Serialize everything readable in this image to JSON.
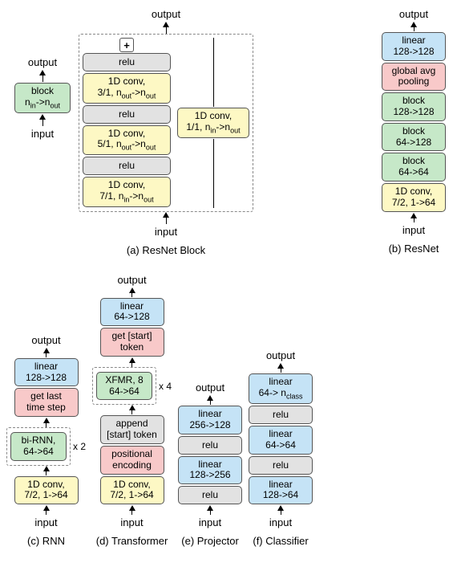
{
  "labels": {
    "input": "input",
    "output": "output"
  },
  "panelA": {
    "caption": "(a) ResNet Block",
    "left_block": {
      "title": "block",
      "dims": "nin->nout"
    },
    "expanded": {
      "plus": "+",
      "relu": "relu",
      "conv3": {
        "l1": "1D conv,",
        "l2": "3/1, nout->nout"
      },
      "conv5": {
        "l1": "1D conv,",
        "l2": "5/1, nout->nout"
      },
      "conv7": {
        "l1": "1D conv,",
        "l2": "7/1, nin->nout"
      },
      "skip": {
        "l1": "1D conv,",
        "l2": "1/1, nin->nout"
      }
    }
  },
  "panelB": {
    "caption": "(b) ResNet",
    "layers": {
      "linear": {
        "l1": "linear",
        "l2": "128->128"
      },
      "gap": {
        "l1": "global avg",
        "l2": "pooling"
      },
      "blk3": {
        "l1": "block",
        "l2": "128->128"
      },
      "blk2": {
        "l1": "block",
        "l2": "64->128"
      },
      "blk1": {
        "l1": "block",
        "l2": "64->64"
      },
      "conv": {
        "l1": "1D conv,",
        "l2": "7/2, 1->64"
      }
    }
  },
  "panelC": {
    "caption": "(c) RNN",
    "repeat": "x 2",
    "layers": {
      "linear": {
        "l1": "linear",
        "l2": "128->128"
      },
      "getlast": {
        "l1": "get last",
        "l2": "time step"
      },
      "birnn": {
        "l1": "bi-RNN,",
        "l2": "64->64"
      },
      "conv": {
        "l1": "1D conv,",
        "l2": "7/2, 1->64"
      }
    }
  },
  "panelD": {
    "caption": "(d) Transformer",
    "repeat": "x 4",
    "layers": {
      "linear": {
        "l1": "linear",
        "l2": "64->128"
      },
      "getstart": {
        "l1": "get [start]",
        "l2": "token"
      },
      "xfmr": {
        "l1": "XFMR, 8",
        "l2": "64->64"
      },
      "append": {
        "l1": "append",
        "l2": "[start] token"
      },
      "posenc": {
        "l1": "positional",
        "l2": "encoding"
      },
      "conv": {
        "l1": "1D conv,",
        "l2": "7/2, 1->64"
      }
    }
  },
  "panelE": {
    "caption": "(e) Projector",
    "layers": {
      "lin2": {
        "l1": "linear",
        "l2": "256->128"
      },
      "relu": "relu",
      "lin1": {
        "l1": "linear",
        "l2": "128->256"
      }
    }
  },
  "panelF": {
    "caption": "(f) Classifier",
    "layers": {
      "lin3": {
        "l1": "linear",
        "l2": "64-> nclass"
      },
      "relu": "relu",
      "lin2": {
        "l1": "linear",
        "l2": "64->64"
      },
      "lin1": {
        "l1": "linear",
        "l2": "128->64"
      }
    }
  }
}
